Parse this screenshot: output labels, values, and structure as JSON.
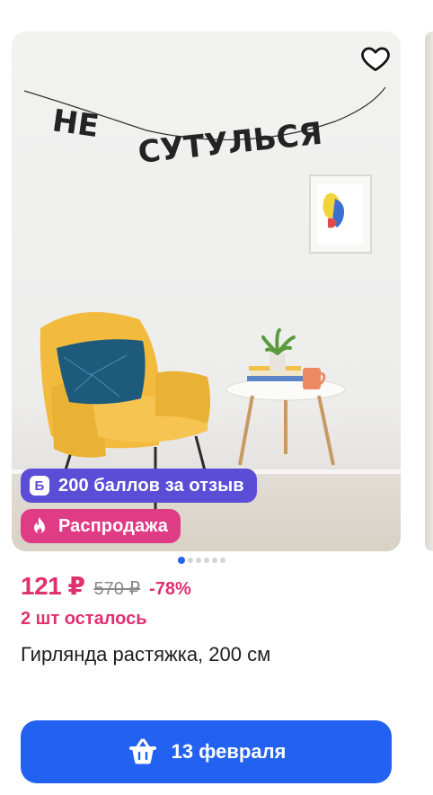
{
  "product": {
    "image": {
      "garland_text": "НЕ СУТУЛЬСЯ",
      "gallery_total": 6,
      "gallery_active": 0
    },
    "favorite_icon": "heart-outline-icon",
    "badges": {
      "points": {
        "icon_letter": "Б",
        "label": "200 баллов за отзыв",
        "color": "#5b4dd6"
      },
      "sale": {
        "icon": "fire-icon",
        "label": "Распродажа",
        "color": "#e03c86"
      }
    },
    "price": {
      "current": "121 ₽",
      "old": "570 ₽",
      "discount": "-78%",
      "accent_color": "#e0306e"
    },
    "stock": "2 шт осталось",
    "title": "Гирлянда растяжка, 200 см",
    "cart_button": {
      "icon": "basket-icon",
      "label": "13 февраля",
      "color": "#2361f0"
    }
  }
}
